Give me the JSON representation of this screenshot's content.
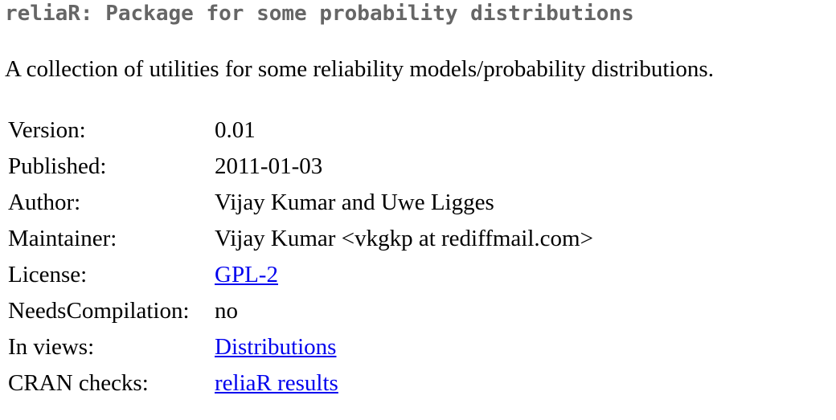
{
  "page": {
    "title": "reliaR: Package for some probability distributions",
    "description": "A collection of utilities for some reliability models/probability distributions."
  },
  "meta": {
    "version_label": "Version:",
    "version_value": "0.01",
    "published_label": "Published:",
    "published_value": "2011-01-03",
    "author_label": "Author:",
    "author_value": "Vijay Kumar and Uwe Ligges",
    "maintainer_label": "Maintainer:",
    "maintainer_value": "Vijay Kumar <vkgkp at rediffmail.com>",
    "license_label": "License:",
    "license_value": "GPL-2",
    "needs_compilation_label": "NeedsCompilation:",
    "needs_compilation_value": "no",
    "in_views_label": "In views:",
    "in_views_value": "Distributions",
    "cran_checks_label": "CRAN checks:",
    "cran_checks_value": "reliaR results"
  },
  "colors": {
    "title": "#666666",
    "link": "#0000ee",
    "text": "#000000",
    "background": "#ffffff"
  }
}
